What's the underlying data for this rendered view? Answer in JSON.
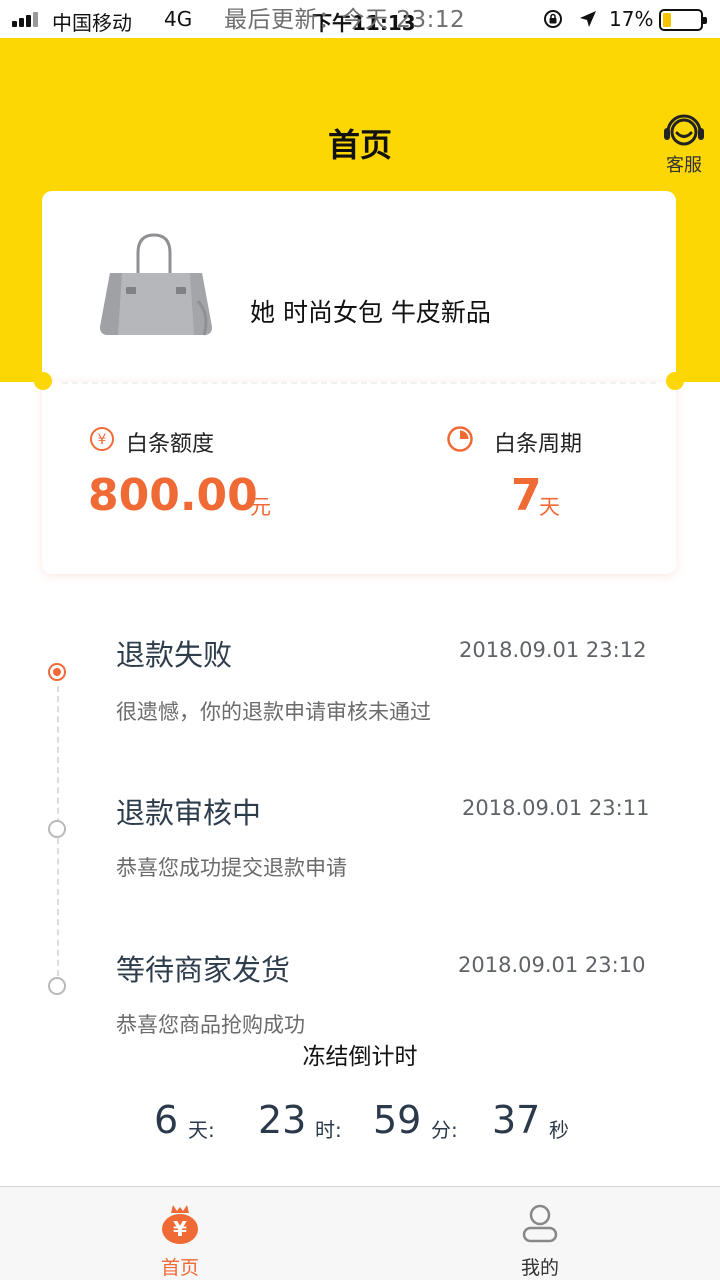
{
  "status_bar": {
    "carrier": "中国移动",
    "network": "4G",
    "time": "下午11:13",
    "updated_text": "最后更新：今天 23:12",
    "battery_percent": "17%",
    "battery_level": 0.17
  },
  "header": {
    "title": "首页",
    "customer_service_label": "客服",
    "customer_service_icon": "headset-icon",
    "background": "#fcd703"
  },
  "product": {
    "image_icon": "handbag-image",
    "name": "她 时尚女包 牛皮新品"
  },
  "credit": {
    "limit_label": "白条额度",
    "limit_value": "800.00",
    "limit_unit": "元",
    "limit_icon": "yen-circle-icon",
    "period_label": "白条周期",
    "period_value": "7",
    "period_unit": "天",
    "period_icon": "pie-clock-icon",
    "accent_color": "#f06a35"
  },
  "timeline": [
    {
      "title": "退款失败",
      "time": "2018.09.01 23:12",
      "desc": "很遗憾，你的退款申请审核未通过",
      "active": true
    },
    {
      "title": "退款审核中",
      "time": "2018.09.01 23:11",
      "desc": "恭喜您成功提交退款申请",
      "active": false
    },
    {
      "title": "等待商家发货",
      "time": "2018.09.01 23:10",
      "desc": "恭喜您商品抢购成功",
      "active": false
    }
  ],
  "countdown": {
    "title": "冻结倒计时",
    "days": "6",
    "days_unit": "天:",
    "hours": "23",
    "hours_unit": "时:",
    "minutes": "59",
    "minutes_unit": "分:",
    "seconds": "37",
    "seconds_unit": "秒"
  },
  "tabbar": {
    "tabs": [
      {
        "label": "首页",
        "icon": "money-bag-icon",
        "active": true,
        "color": "#f06a35"
      },
      {
        "label": "我的",
        "icon": "user-icon",
        "active": false,
        "color": "#333333"
      }
    ]
  }
}
